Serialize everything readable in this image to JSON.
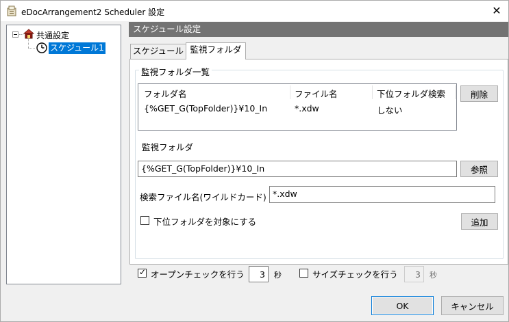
{
  "window": {
    "title": "eDocArrangement2 Scheduler 設定",
    "close_label": "✕"
  },
  "tree": {
    "root_label": "共通設定",
    "child_label": "スケジュール1"
  },
  "section_header": "スケジュール設定",
  "tabs": [
    {
      "label": "スケジュール"
    },
    {
      "label": "監視フォルダ"
    }
  ],
  "watch_list": {
    "group_title": "監視フォルダ一覧",
    "columns": [
      "フォルダ名",
      "ファイル名",
      "下位フォルダ検索"
    ],
    "rows": [
      {
        "folder": "{%GET_G(TopFolder)}¥10_In",
        "file": "*.xdw",
        "subfolder": "しない"
      }
    ],
    "delete_label": "削除"
  },
  "watch_folder": {
    "label": "監視フォルダ",
    "value": "{%GET_G(TopFolder)}¥10_In",
    "browse_label": "参照"
  },
  "search_file": {
    "label": "検索ファイル名(ワイルドカード)",
    "value": "*.xdw"
  },
  "subfolder_option": {
    "label": "下位フォルダを対象にする",
    "checked": false
  },
  "add_label": "追加",
  "open_check": {
    "label": "オープンチェックを行う",
    "checked": true,
    "seconds": "3",
    "unit": "秒"
  },
  "size_check": {
    "label": "サイズチェックを行う",
    "checked": false,
    "seconds": "3",
    "unit": "秒"
  },
  "footer": {
    "ok_label": "OK",
    "cancel_label": "キャンセル"
  }
}
